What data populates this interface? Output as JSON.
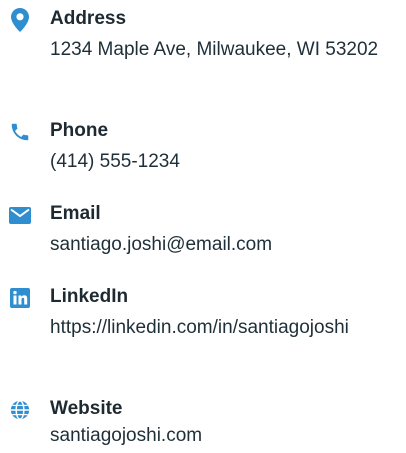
{
  "colors": {
    "accent": "#2f8ed0",
    "label": "#1e2a32",
    "value": "#1f2f38"
  },
  "contacts": [
    {
      "icon": "location-pin-icon",
      "label": "Address",
      "value": "1234 Maple Ave, Milwaukee, WI 53202"
    },
    {
      "icon": "phone-icon",
      "label": "Phone",
      "value": "(414) 555-1234"
    },
    {
      "icon": "envelope-icon",
      "label": "Email",
      "value": "santiago.joshi@email.com"
    },
    {
      "icon": "linkedin-icon",
      "label": "LinkedIn",
      "value": "https://linkedin.com/in/santiagojoshi"
    },
    {
      "icon": "globe-icon",
      "label": "Website",
      "value": "santiagojoshi.com"
    }
  ]
}
